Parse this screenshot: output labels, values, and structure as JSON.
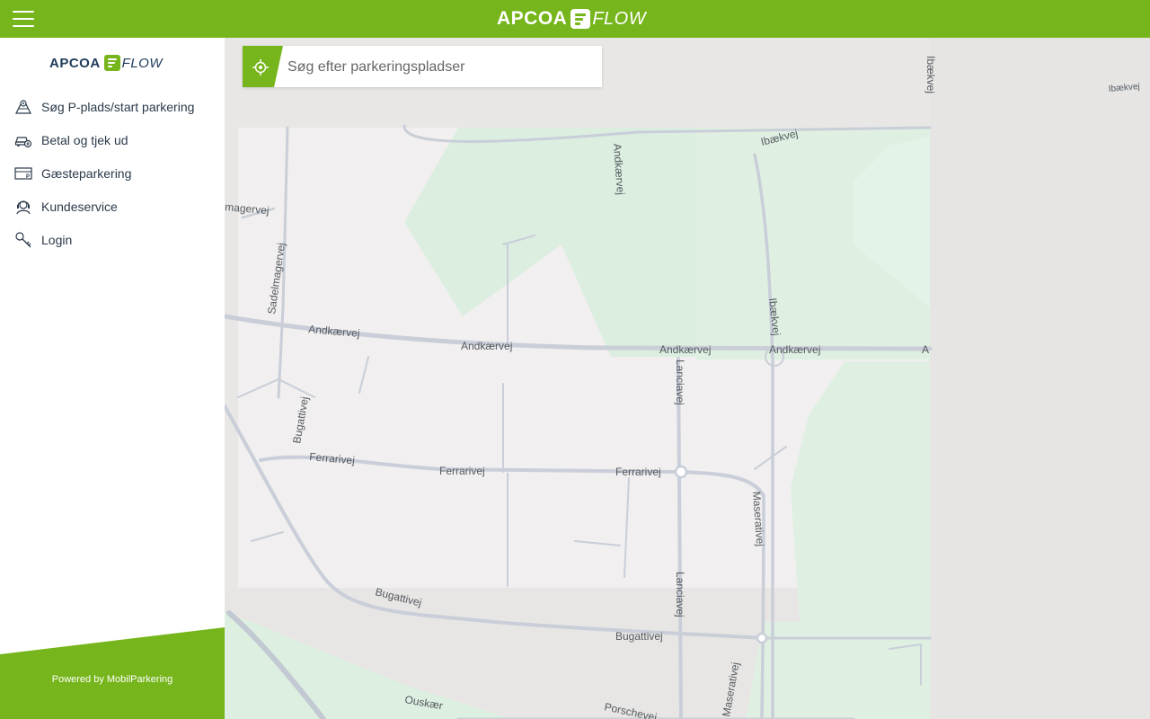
{
  "header": {
    "logo_apcoa": "APCOA",
    "logo_flow": "FLOW",
    "menu_icon": "hamburger-icon"
  },
  "sidebar": {
    "logo_apcoa": "APCOA",
    "logo_flow": "FLOW",
    "items": [
      {
        "label": "Søg P-plads/start parkering",
        "icon": "parking-map-icon"
      },
      {
        "label": "Betal og tjek ud",
        "icon": "car-pay-icon"
      },
      {
        "label": "Gæsteparkering",
        "icon": "guest-parking-ticket-icon"
      },
      {
        "label": "Kundeservice",
        "icon": "customer-service-icon"
      },
      {
        "label": "Login",
        "icon": "key-icon"
      }
    ],
    "footer_prefix": "Powered by ",
    "footer_brand": "MobilParkering"
  },
  "search": {
    "placeholder": "Søg efter parkeringspladser",
    "value": "",
    "locate_icon": "locate-icon"
  },
  "map": {
    "street_labels": {
      "ibaekvej_top": "Ibækvej",
      "ibaekvej_right": "Ibækvej",
      "ibaekvej_curve": "Ibækvej",
      "ibaekvej_mid": "Ibækvej",
      "andkaervej_vertical": "Andkærvej",
      "magervej": "magervej",
      "sadelmagervej": "Sadelmagervej",
      "andkaervej_1": "Andkærvej",
      "andkaervej_2": "Andkærvej",
      "andkaervej_3": "Andkærvej",
      "andkaervej_4": "Andkærvej",
      "andkaervej_cut": "A",
      "lanciavej_1": "Lanciavej",
      "lanciavej_2": "Lanciavej",
      "bugattivej_1": "Bugattivej",
      "ferrarivej_1": "Ferrarivej",
      "ferrarivej_2": "Ferrarivej",
      "ferrarivej_3": "Ferrarivej",
      "maserativej_1": "Maserativej",
      "maserativej_2": "Maserativej",
      "bugattivej_2": "Bugattivej",
      "bugattivej_3": "Bugattivej",
      "ouskaer": "Ouskær",
      "porschevej": "Porschevej"
    }
  },
  "colors": {
    "brand_green": "#76b51b",
    "logo_navy": "#1f3c5a",
    "text_dark": "#2b3a4a"
  }
}
